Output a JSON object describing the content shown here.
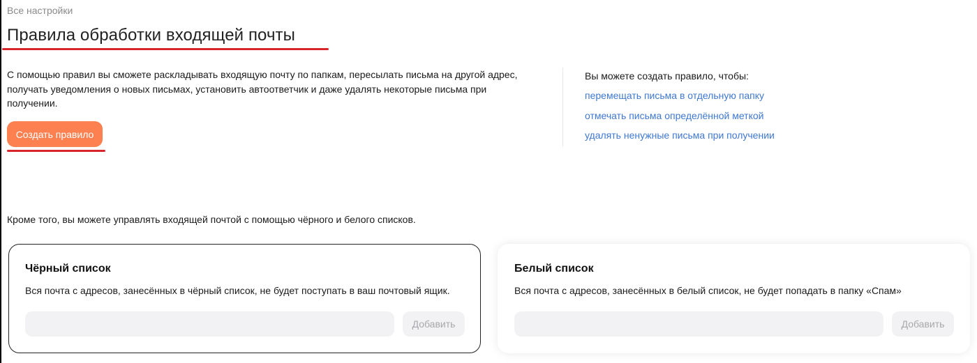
{
  "breadcrumb": "Все настройки",
  "page_title": "Правила обработки входящей почты",
  "intro_text": "С помощью правил вы сможете раскладывать входящую почту по папкам, пересылать письма на другой адрес, получать уведомления о новых письмах, установить автоответчик и даже удалять некоторые письма при получении.",
  "create_rule_label": "Создать правило",
  "tips": {
    "heading": "Вы можете создать правило, чтобы:",
    "links": [
      "перемещать письма в отдельную папку",
      "отмечать письма определённой меткой",
      "удалять ненужные письма при получении"
    ]
  },
  "lists_intro": "Кроме того, вы можете управлять входящей почтой с помощью чёрного и белого списков.",
  "blacklist": {
    "title": "Чёрный список",
    "description": "Вся почта с адресов, занесённых в чёрный список, не будет поступать в ваш почтовый ящик.",
    "input_value": "",
    "add_label": "Добавить"
  },
  "whitelist": {
    "title": "Белый список",
    "description": "Вся почта с адресов, занесённых в белый список, не будет попадать в папку «Спам»",
    "input_value": "",
    "add_label": "Добавить"
  },
  "colors": {
    "accent_button": "#fc8050",
    "link": "#3f78d1",
    "annotation_underline": "#d8242b"
  }
}
